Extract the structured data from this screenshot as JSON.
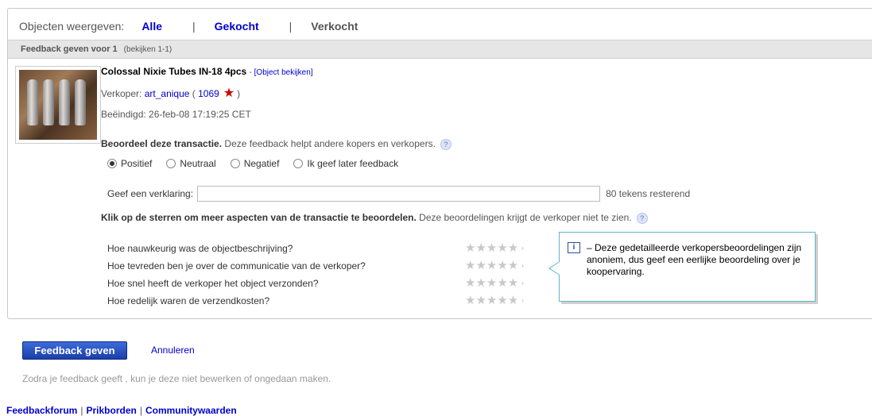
{
  "filter": {
    "label": "Objecten weergeven:",
    "options": [
      "Alle",
      "Gekocht",
      "Verkocht"
    ],
    "separator": "|"
  },
  "bar": {
    "title": "Feedback geven voor 1",
    "subtitle": "(bekijken 1-1)"
  },
  "item": {
    "title": "Colossal Nixie Tubes IN-18 4pcs",
    "dash": "-",
    "view_link": "[Object bekijken]",
    "seller_label": "Verkoper:",
    "seller_name": "art_anique",
    "seller_score": "1069",
    "open_paren": "(",
    "close_paren": ")",
    "ended": "Beëindigd: 26-feb-08 17:19:25 CET"
  },
  "rate": {
    "bold": "Beoordeel deze transactie.",
    "text": "Deze feedback helpt andere kopers en verkopers.",
    "help": "?"
  },
  "radios": [
    "Positief",
    "Neutraal",
    "Negatief",
    "Ik geef later feedback"
  ],
  "explanation": {
    "label": "Geef een verklaring:",
    "value": "",
    "remaining": "80 tekens resterend"
  },
  "aspects": {
    "bold": "Klik op de sterren om meer aspecten van de transactie te beoordelen.",
    "text": "Deze beoordelingen krijgt de verkoper niet te zien.",
    "help": "?",
    "questions": [
      "Hoe nauwkeurig was de objectbeschrijving?",
      "Hoe tevreden ben je over de communicatie van de verkoper?",
      "Hoe snel heeft de verkoper het object verzonden?",
      "Hoe redelijk waren de verzendkosten?"
    ],
    "stars": "★★★★★",
    "arrow": "›"
  },
  "tooltip": {
    "icon": "i",
    "text": "– Deze gedetailleerde verkopersbeoordelingen zijn anoniem, dus geef een eerlijke beoordeling over je koopervaring."
  },
  "actions": {
    "submit": "Feedback geven",
    "cancel": "Annuleren"
  },
  "note": "Zodra je feedback geeft , kun je deze niet bewerken of ongedaan maken.",
  "footer": {
    "links": [
      "Feedbackforum",
      "Prikborden",
      "Communitywaarden"
    ],
    "separator": "|"
  },
  "colors": {
    "link": "#0000cc",
    "button": "#1a3fa8",
    "star": "#cc0000",
    "tooltip_border": "#5fb5c8"
  }
}
